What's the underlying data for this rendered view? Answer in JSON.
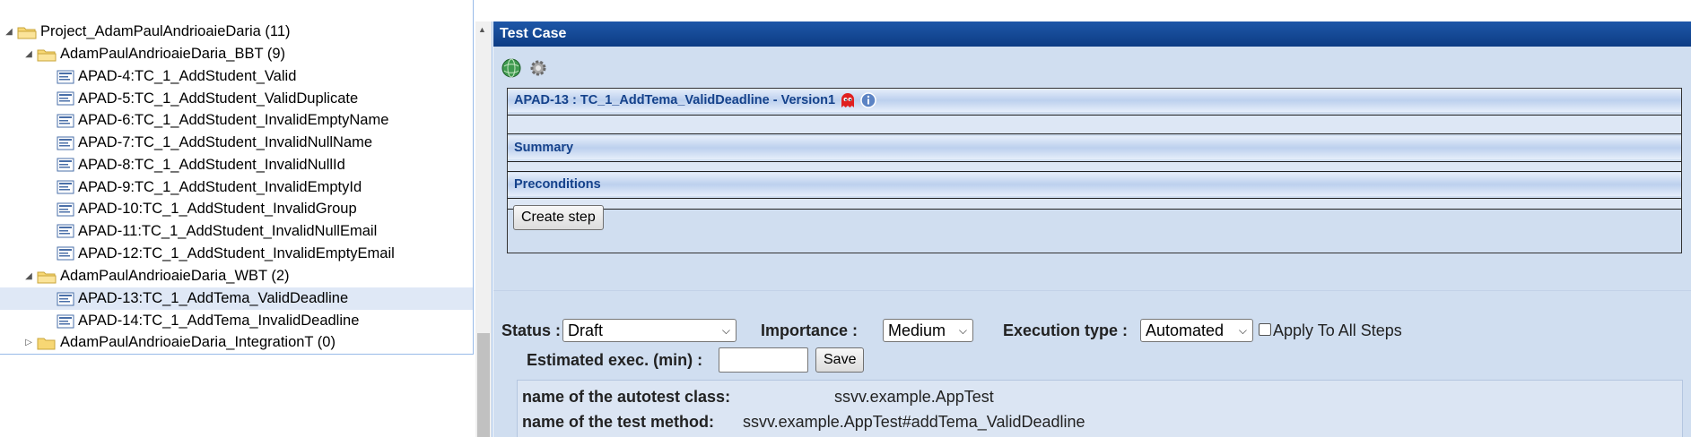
{
  "tree": {
    "root": {
      "label": "Project_AdamPaulAndrioaieDaria (11)",
      "expanded": true
    },
    "suites": [
      {
        "label": "AdamPaulAndrioaieDaria_BBT (9)",
        "expanded": true,
        "cases": [
          "APAD-4:TC_1_AddStudent_Valid",
          "APAD-5:TC_1_AddStudent_ValidDuplicate",
          "APAD-6:TC_1_AddStudent_InvalidEmptyName",
          "APAD-7:TC_1_AddStudent_InvalidNullName",
          "APAD-8:TC_1_AddStudent_InvalidNullId",
          "APAD-9:TC_1_AddStudent_InvalidEmptyId",
          "APAD-10:TC_1_AddStudent_InvalidGroup",
          "APAD-11:TC_1_AddStudent_InvalidNullEmail",
          "APAD-12:TC_1_AddStudent_InvalidEmptyEmail"
        ]
      },
      {
        "label": "AdamPaulAndrioaieDaria_WBT (2)",
        "expanded": true,
        "cases": [
          "APAD-13:TC_1_AddTema_ValidDeadline",
          "APAD-14:TC_1_AddTema_InvalidDeadline"
        ]
      },
      {
        "label": "AdamPaulAndrioaieDaria_IntegrationT (0)",
        "expanded": false,
        "cases": []
      }
    ],
    "selected_case": "APAD-13:TC_1_AddTema_ValidDeadline"
  },
  "panel": {
    "header": "Test Case",
    "toolbar_icons": [
      "globe-icon",
      "gear-icon"
    ],
    "testcase_title": "APAD-13 : TC_1_AddTema_ValidDeadline - Version1",
    "title_badges": [
      "ghost-icon",
      "info-icon"
    ],
    "sections": {
      "summary": "Summary",
      "preconditions": "Preconditions"
    },
    "create_step": "Create step",
    "status": {
      "label": "Status :",
      "value": "Draft"
    },
    "importance": {
      "label": "Importance :",
      "value": "Medium"
    },
    "execution_type": {
      "label": "Execution type :",
      "value": "Automated"
    },
    "apply_all": {
      "label": "Apply To All Steps",
      "checked": false
    },
    "estimated": {
      "label": "Estimated exec. (min) :",
      "value": "",
      "save": "Save"
    },
    "custom_fields": [
      {
        "name": "name of the autotest class:",
        "value": "ssvv.example.AppTest"
      },
      {
        "name": "name of the test method:",
        "value": "ssvv.example.AppTest#addTema_ValidDeadline"
      }
    ]
  },
  "colors": {
    "header_bg": "#15428b",
    "panel_bg": "#d0def0",
    "selection": "#dfe8f6",
    "bar_text": "#15428b"
  }
}
